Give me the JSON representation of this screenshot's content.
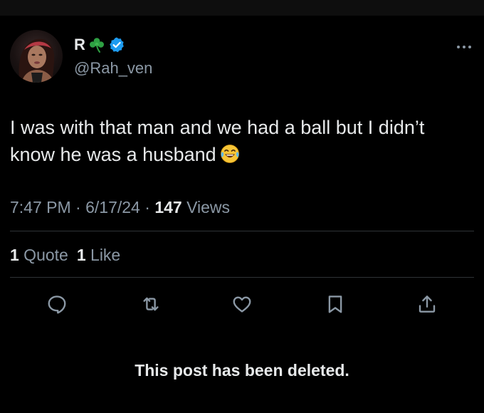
{
  "user": {
    "display_name": "R",
    "handle": "@Rah_ven",
    "name_icons": [
      "shamrock-icon",
      "verified-badge-icon"
    ],
    "verified_color": "#1d9bf0",
    "shamrock_color": "#2ea043"
  },
  "tweet": {
    "text": "I was with that man and we had a ball but I didn’t know he was a husband",
    "emoji": "face-with-tears-of-joy-icon"
  },
  "meta": {
    "time": "7:47 PM",
    "separator": " · ",
    "date": "6/17/24",
    "views_count": "147",
    "views_label": " Views"
  },
  "stats": {
    "quotes_count": "1",
    "quotes_label": " Quote",
    "likes_count": "1",
    "likes_label": " Like"
  },
  "actions": [
    "reply-icon",
    "retweet-icon",
    "like-icon",
    "bookmark-icon",
    "share-icon"
  ],
  "status_message": "This post has been deleted.",
  "colors": {
    "background": "#000000",
    "text_primary": "#e7e9ea",
    "text_secondary": "#8b98a5",
    "divider": "#2f3336"
  }
}
